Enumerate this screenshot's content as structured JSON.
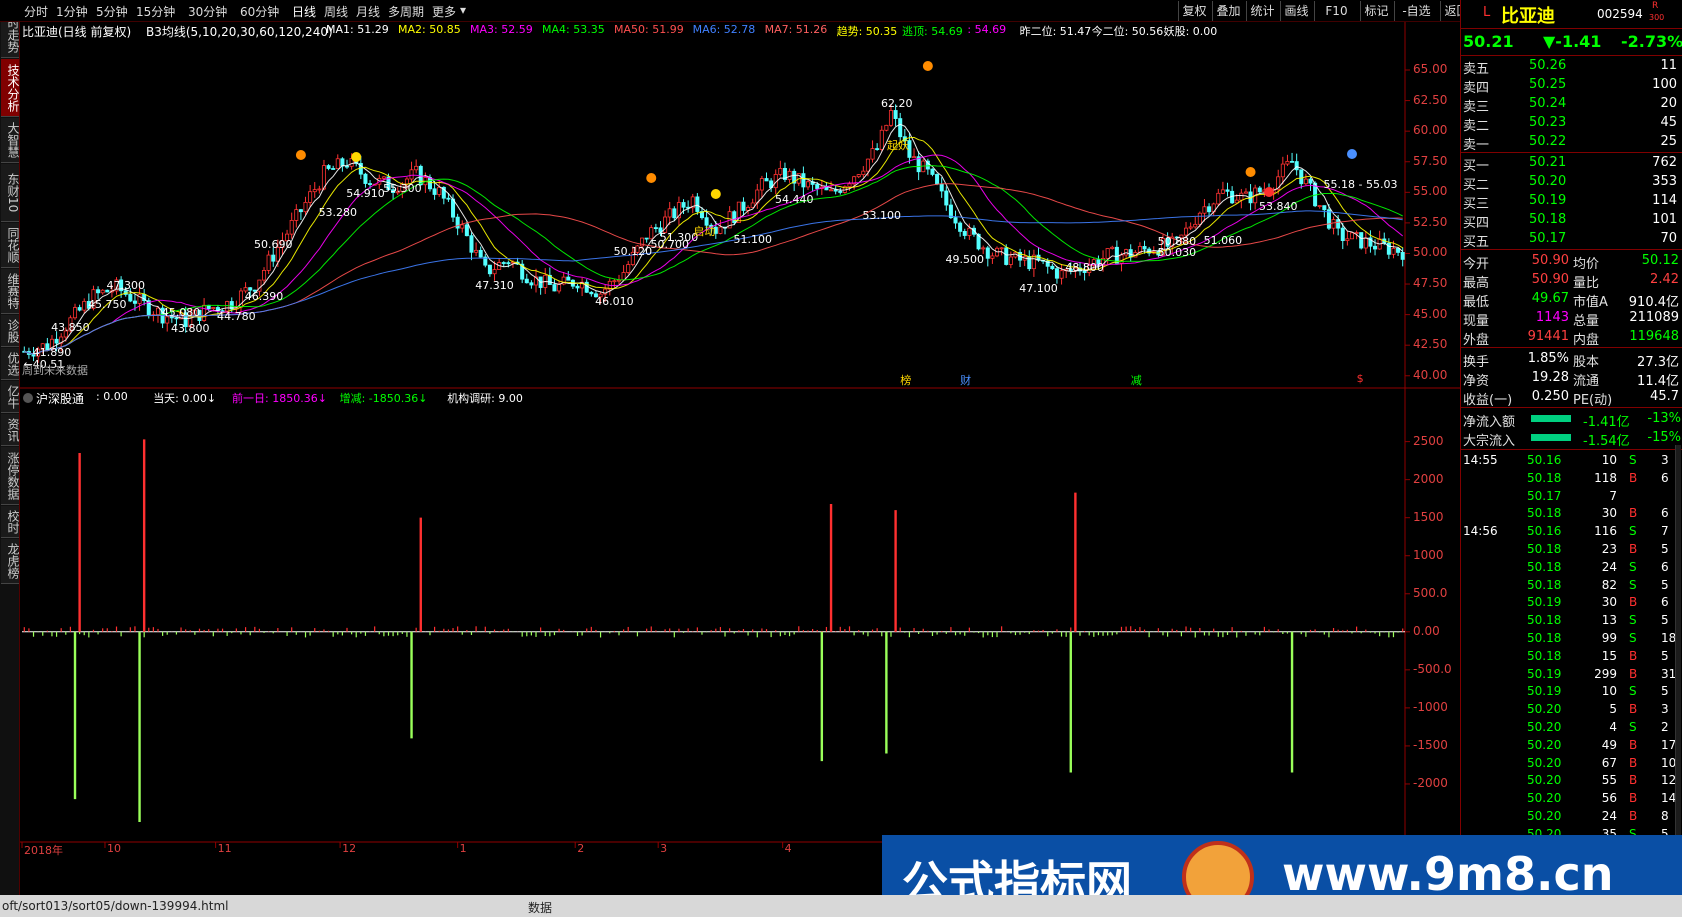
{
  "toolbar": {
    "periods": [
      "分时",
      "1分钟",
      "5分钟",
      "15分钟",
      "30分钟",
      "60分钟",
      "日线",
      "周线",
      "月线",
      "多周期",
      "更多"
    ],
    "active_period": "日线",
    "buttons": [
      "复权",
      "叠加",
      "统计",
      "画线",
      "F10",
      "标记",
      "-自选",
      "返回"
    ]
  },
  "left_tabs": [
    "分时走势",
    "技术分析",
    "大智慧",
    "东财10",
    "同花顺",
    "维赛特",
    "诊股",
    "优选",
    "亿牛",
    "资讯",
    "涨停数据",
    "校时",
    "龙虎榜"
  ],
  "active_left_tab": "技术分析",
  "main_header": {
    "stock": "比亚迪(日线 前复权)",
    "indicator": "B3均线(5,10,20,30,60,120,240)",
    "items": [
      {
        "text": "MA1: 51.29",
        "color": "#ffffff"
      },
      {
        "text": "MA2: 50.85",
        "color": "#ffff00"
      },
      {
        "text": "MA3: 52.59",
        "color": "#ff00ff"
      },
      {
        "text": "MA4: 53.35",
        "color": "#00ff00"
      },
      {
        "text": "MA50: 51.99",
        "color": "#ff5050"
      },
      {
        "text": "MA6: 52.78",
        "color": "#4080ff"
      },
      {
        "text": "MA7: 51.26",
        "color": "#ff6060"
      },
      {
        "text": "趋势: 50.35",
        "color": "#ffff00"
      },
      {
        "text": "逃顶: 54.69",
        "color": "#00ff00"
      },
      {
        "text": ": 54.69",
        "color": "#ff00ff"
      },
      {
        "text": "昨二位: 51.47",
        "color": "#ffffff"
      },
      {
        "text": "今二位: 50.56",
        "color": "#ffffff"
      },
      {
        "text": "妖股: 0.00",
        "color": "#ffffff"
      }
    ]
  },
  "price_axis": [
    "65.00",
    "62.50",
    "60.00",
    "57.50",
    "55.00",
    "52.50",
    "50.00",
    "47.50",
    "45.00",
    "42.50",
    "40.00"
  ],
  "price_annotations": [
    {
      "text": "62.20",
      "price": 62.2,
      "idx": 188
    },
    {
      "text": "55.18 - 55.03",
      "price": 55.6,
      "idx": 284
    },
    {
      "text": "54.910",
      "price": 54.9,
      "idx": 72
    },
    {
      "text": "55.300",
      "price": 55.3,
      "idx": 80
    },
    {
      "text": "53.280",
      "price": 53.3,
      "idx": 66
    },
    {
      "text": "54.440",
      "price": 54.4,
      "idx": 165
    },
    {
      "text": "53.840",
      "price": 53.8,
      "idx": 270
    },
    {
      "text": "53.100",
      "price": 53.1,
      "idx": 184
    },
    {
      "text": "50.690",
      "price": 50.7,
      "idx": 52
    },
    {
      "text": "51.300",
      "price": 51.3,
      "idx": 140
    },
    {
      "text": "50.700",
      "price": 50.7,
      "idx": 138
    },
    {
      "text": "51.100",
      "price": 51.1,
      "idx": 156
    },
    {
      "text": "50.120",
      "price": 50.1,
      "idx": 130
    },
    {
      "text": "50.880",
      "price": 50.9,
      "idx": 248
    },
    {
      "text": "51.060",
      "price": 51.0,
      "idx": 258
    },
    {
      "text": "50.030",
      "price": 50.0,
      "idx": 248
    },
    {
      "text": "49.500",
      "price": 49.5,
      "idx": 202
    },
    {
      "text": "48.800",
      "price": 48.8,
      "idx": 228
    },
    {
      "text": "47.310",
      "price": 47.3,
      "idx": 100
    },
    {
      "text": "47.100",
      "price": 47.1,
      "idx": 218
    },
    {
      "text": "46.390",
      "price": 46.4,
      "idx": 50
    },
    {
      "text": "46.010",
      "price": 46.0,
      "idx": 126
    },
    {
      "text": "47.300",
      "price": 47.3,
      "idx": 20
    },
    {
      "text": "45.750",
      "price": 45.8,
      "idx": 16
    },
    {
      "text": "45.080",
      "price": 45.1,
      "idx": 32
    },
    {
      "text": "44.780",
      "price": 44.8,
      "idx": 44
    },
    {
      "text": "43.800",
      "price": 43.8,
      "idx": 34
    },
    {
      "text": "43.850",
      "price": 43.9,
      "idx": 8
    },
    {
      "text": "41.890",
      "price": 41.9,
      "idx": 4
    },
    {
      "text": "←40.51",
      "price": 40.9,
      "idx": 2
    }
  ],
  "yellow_labels": [
    "启动",
    "起妖"
  ],
  "future_text": "周到未来数据",
  "event_marks": [
    "榜",
    "财",
    "减",
    "$"
  ],
  "sub_header": {
    "name": "沪深股通",
    "items": [
      {
        "text": ": 0.00",
        "color": "#ffffff"
      },
      {
        "text": "当天: 0.00↓",
        "color": "#ffffff"
      },
      {
        "text": "前一日: 1850.36↓",
        "color": "#ff00ff"
      },
      {
        "text": "增减: -1850.36↓",
        "color": "#00ff00"
      },
      {
        "text": "机构调研: 9.00",
        "color": "#ffffff"
      }
    ]
  },
  "sub_axis": [
    "2500",
    "2000",
    "1500",
    "1000",
    "500.0",
    "0.00",
    "-500.0",
    "-1000",
    "-1500",
    "-2000"
  ],
  "time_axis": [
    {
      "text": "2018年",
      "pos": 0.0
    },
    {
      "text": "10",
      "pos": 0.06
    },
    {
      "text": "11",
      "pos": 0.14
    },
    {
      "text": "12",
      "pos": 0.23
    },
    {
      "text": "1",
      "pos": 0.315
    },
    {
      "text": "2",
      "pos": 0.4
    },
    {
      "text": "3",
      "pos": 0.46
    },
    {
      "text": "4",
      "pos": 0.55
    },
    {
      "text": "5",
      "pos": 0.64
    }
  ],
  "chart_data": {
    "type": "bar",
    "title": "沪深股通",
    "price_range": [
      39.0,
      66.8
    ],
    "flow_range": [
      -2500,
      2600
    ],
    "n_candles": 300,
    "price_path": [
      [
        0,
        42.0
      ],
      [
        5,
        42.5
      ],
      [
        10,
        44.5
      ],
      [
        15,
        46.5
      ],
      [
        20,
        47.2
      ],
      [
        25,
        46.0
      ],
      [
        30,
        45.0
      ],
      [
        35,
        44.5
      ],
      [
        40,
        45.5
      ],
      [
        45,
        46.0
      ],
      [
        50,
        47.5
      ],
      [
        55,
        50.5
      ],
      [
        60,
        53.5
      ],
      [
        65,
        56.5
      ],
      [
        70,
        57.5
      ],
      [
        75,
        56.0
      ],
      [
        80,
        55.5
      ],
      [
        85,
        56.5
      ],
      [
        90,
        55.0
      ],
      [
        95,
        52.0
      ],
      [
        100,
        48.5
      ],
      [
        105,
        49.5
      ],
      [
        110,
        48.0
      ],
      [
        115,
        47.2
      ],
      [
        120,
        47.8
      ],
      [
        125,
        46.8
      ],
      [
        130,
        48.5
      ],
      [
        135,
        51.5
      ],
      [
        140,
        53.0
      ],
      [
        145,
        54.5
      ],
      [
        150,
        52.0
      ],
      [
        155,
        53.5
      ],
      [
        160,
        55.5
      ],
      [
        165,
        56.5
      ],
      [
        170,
        55.5
      ],
      [
        175,
        54.8
      ],
      [
        180,
        56.5
      ],
      [
        185,
        58.5
      ],
      [
        188,
        61.5
      ],
      [
        192,
        58.0
      ],
      [
        196,
        56.5
      ],
      [
        200,
        54.0
      ],
      [
        205,
        51.5
      ],
      [
        210,
        50.0
      ],
      [
        215,
        49.5
      ],
      [
        220,
        49.2
      ],
      [
        225,
        48.3
      ],
      [
        230,
        49.0
      ],
      [
        235,
        49.8
      ],
      [
        240,
        50.0
      ],
      [
        245,
        50.5
      ],
      [
        250,
        50.7
      ],
      [
        255,
        53.5
      ],
      [
        260,
        55.0
      ],
      [
        265,
        54.5
      ],
      [
        270,
        55.5
      ],
      [
        275,
        57.5
      ],
      [
        280,
        54.5
      ],
      [
        285,
        51.5
      ],
      [
        290,
        51.0
      ],
      [
        295,
        50.5
      ],
      [
        299,
        50.2
      ]
    ],
    "flow_bars": [
      {
        "idx": 12,
        "value": 2350
      },
      {
        "idx": 11,
        "value": -2200
      },
      {
        "idx": 26,
        "value": 2530
      },
      {
        "idx": 25,
        "value": -2500
      },
      {
        "idx": 86,
        "value": 1500
      },
      {
        "idx": 84,
        "value": -1400
      },
      {
        "idx": 175,
        "value": 1680
      },
      {
        "idx": 173,
        "value": -1700
      },
      {
        "idx": 189,
        "value": 1600
      },
      {
        "idx": 187,
        "value": -1600
      },
      {
        "idx": 228,
        "value": 1830
      },
      {
        "idx": 227,
        "value": -1850
      },
      {
        "idx": 275,
        "value": -1850
      }
    ]
  },
  "right_panel": {
    "code_prefix": "L",
    "name": "比亚迪",
    "code": "002594",
    "code_tag": "R",
    "code_sub": "300",
    "price": "50.21",
    "change": "▼-1.41",
    "change_pct": "-2.73%",
    "sells": [
      {
        "label": "卖五",
        "price": "50.26",
        "vol": "11"
      },
      {
        "label": "卖四",
        "price": "50.25",
        "vol": "100"
      },
      {
        "label": "卖三",
        "price": "50.24",
        "vol": "20"
      },
      {
        "label": "卖二",
        "price": "50.23",
        "vol": "45"
      },
      {
        "label": "卖一",
        "price": "50.22",
        "vol": "25"
      }
    ],
    "buys": [
      {
        "label": "买一",
        "price": "50.21",
        "vol": "762"
      },
      {
        "label": "买二",
        "price": "50.20",
        "vol": "353"
      },
      {
        "label": "买三",
        "price": "50.19",
        "vol": "114"
      },
      {
        "label": "买四",
        "price": "50.18",
        "vol": "101"
      },
      {
        "label": "买五",
        "price": "50.17",
        "vol": "70"
      }
    ],
    "stats": [
      {
        "l1": "今开",
        "v1": "50.90",
        "c1": "#ff4040",
        "l2": "均价",
        "v2": "50.12",
        "c2": "#00ff00"
      },
      {
        "l1": "最高",
        "v1": "50.90",
        "c1": "#ff4040",
        "l2": "量比",
        "v2": "2.42",
        "c2": "#ff4040"
      },
      {
        "l1": "最低",
        "v1": "49.67",
        "c1": "#00ff00",
        "l2": "市值A",
        "v2": "910.4亿",
        "c2": "#ffffff"
      },
      {
        "l1": "现量",
        "v1": "1143",
        "c1": "#ff00ff",
        "l2": "总量",
        "v2": "211089",
        "c2": "#ffffff"
      },
      {
        "l1": "外盘",
        "v1": "91441",
        "c1": "#ff4040",
        "l2": "内盘",
        "v2": "119648",
        "c2": "#00ff00"
      }
    ],
    "stats2": [
      {
        "l1": "换手",
        "v1": "1.85%",
        "l2": "股本",
        "v2": "27.3亿"
      },
      {
        "l1": "净资",
        "v1": "19.28",
        "l2": "流通",
        "v2": "11.4亿"
      },
      {
        "l1": "收益(一)",
        "v1": "0.250",
        "l2": "PE(动)",
        "v2": "45.7"
      }
    ],
    "flows": [
      {
        "label": "净流入额",
        "value": "-1.41亿",
        "pct": "-13%"
      },
      {
        "label": "大宗流入",
        "value": "-1.54亿",
        "pct": "-15%"
      }
    ],
    "ticks": [
      {
        "time": "14:55",
        "price": "50.16",
        "vol": "10",
        "bs": "S",
        "n": "3"
      },
      {
        "time": "",
        "price": "50.18",
        "vol": "118",
        "bs": "B",
        "n": "6"
      },
      {
        "time": "",
        "price": "50.17",
        "vol": "7",
        "bs": "",
        "n": ""
      },
      {
        "time": "",
        "price": "50.18",
        "vol": "30",
        "bs": "B",
        "n": "6"
      },
      {
        "time": "14:56",
        "price": "50.16",
        "vol": "116",
        "bs": "S",
        "n": "7"
      },
      {
        "time": "",
        "price": "50.18",
        "vol": "23",
        "bs": "B",
        "n": "5"
      },
      {
        "time": "",
        "price": "50.18",
        "vol": "24",
        "bs": "S",
        "n": "6"
      },
      {
        "time": "",
        "price": "50.18",
        "vol": "82",
        "bs": "S",
        "n": "5"
      },
      {
        "time": "",
        "price": "50.19",
        "vol": "30",
        "bs": "B",
        "n": "6"
      },
      {
        "time": "",
        "price": "50.18",
        "vol": "13",
        "bs": "S",
        "n": "5"
      },
      {
        "time": "",
        "price": "50.18",
        "vol": "99",
        "bs": "S",
        "n": "18"
      },
      {
        "time": "",
        "price": "50.18",
        "vol": "15",
        "bs": "B",
        "n": "5"
      },
      {
        "time": "",
        "price": "50.19",
        "vol": "299",
        "bs": "B",
        "n": "31"
      },
      {
        "time": "",
        "price": "50.19",
        "vol": "10",
        "bs": "S",
        "n": "5"
      },
      {
        "time": "",
        "price": "50.20",
        "vol": "5",
        "bs": "B",
        "n": "3"
      },
      {
        "time": "",
        "price": "50.20",
        "vol": "4",
        "bs": "S",
        "n": "2"
      },
      {
        "time": "",
        "price": "50.20",
        "vol": "49",
        "bs": "B",
        "n": "17"
      },
      {
        "time": "",
        "price": "50.20",
        "vol": "67",
        "bs": "B",
        "n": "10"
      },
      {
        "time": "",
        "price": "50.20",
        "vol": "55",
        "bs": "B",
        "n": "12"
      },
      {
        "time": "",
        "price": "50.20",
        "vol": "56",
        "bs": "B",
        "n": "14"
      },
      {
        "time": "",
        "price": "50.20",
        "vol": "24",
        "bs": "B",
        "n": "8"
      },
      {
        "time": "",
        "price": "50.20",
        "vol": "35",
        "bs": "S",
        "n": "5"
      }
    ]
  },
  "statusbar": {
    "url": "oft/sort013/sort05/down-139994.html",
    "tab": "数据"
  },
  "watermark": {
    "title": "公式指标网",
    "url": "www.9m8.cn"
  }
}
